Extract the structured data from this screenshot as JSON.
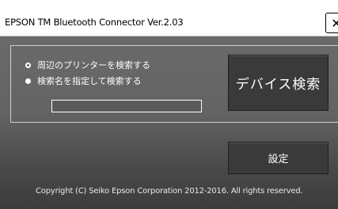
{
  "window": {
    "title": "EPSON TM Bluetooth Connector Ver.2.03",
    "close_glyph": "✕"
  },
  "search_options": {
    "option_nearby": "周辺のプリンターを検索する",
    "option_by_name": "検索名を指定して検索する",
    "name_input_value": ""
  },
  "buttons": {
    "device_search": "デバイス検索",
    "settings": "設定"
  },
  "footer": {
    "copyright": "Copyright (C) Seiko Epson Corporation 2012-2016. All rights reserved."
  },
  "icons": [
    "close-icon",
    "radio-unchecked-icon",
    "radio-checked-icon"
  ]
}
